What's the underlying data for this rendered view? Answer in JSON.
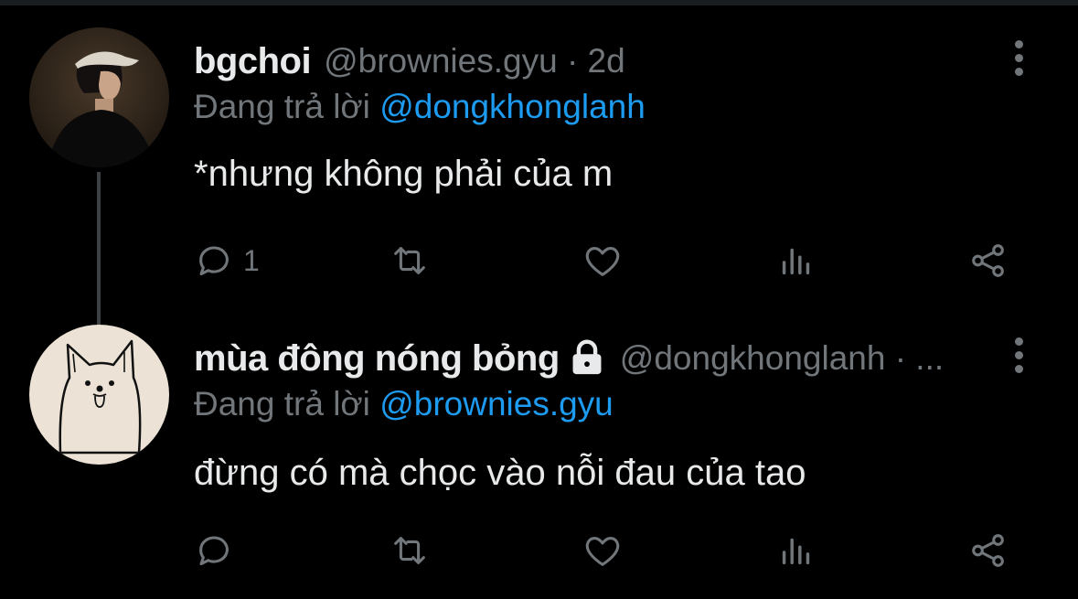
{
  "tweets": [
    {
      "display_name": "bgchoi",
      "handle_meta": "@brownies.gyu · 2d",
      "reply_prefix": "Đang trả lời",
      "reply_to": "@dongkhonglanh",
      "text": "*nhưng không phải của m",
      "reply_count": "1",
      "avatar_icon": "person-photo-avatar",
      "protected": false
    },
    {
      "display_name": "mùa đông nóng bỏng",
      "handle_meta": "@dongkhonglanh · ...",
      "reply_prefix": "Đang trả lời",
      "reply_to": "@brownies.gyu",
      "text": "đừng có mà chọc vào nỗi đau của tao",
      "reply_count": "",
      "avatar_icon": "dog-drawing-avatar",
      "protected": true
    }
  ],
  "icons": {
    "reply": "reply-icon",
    "retweet": "retweet-icon",
    "like": "heart-icon",
    "stats": "stats-icon",
    "share": "share-icon",
    "more": "more-vertical-icon",
    "lock": "lock-icon"
  },
  "colors": {
    "background": "#000000",
    "text": "#e7e9ea",
    "muted": "#71767b",
    "link": "#1d9bf0"
  }
}
